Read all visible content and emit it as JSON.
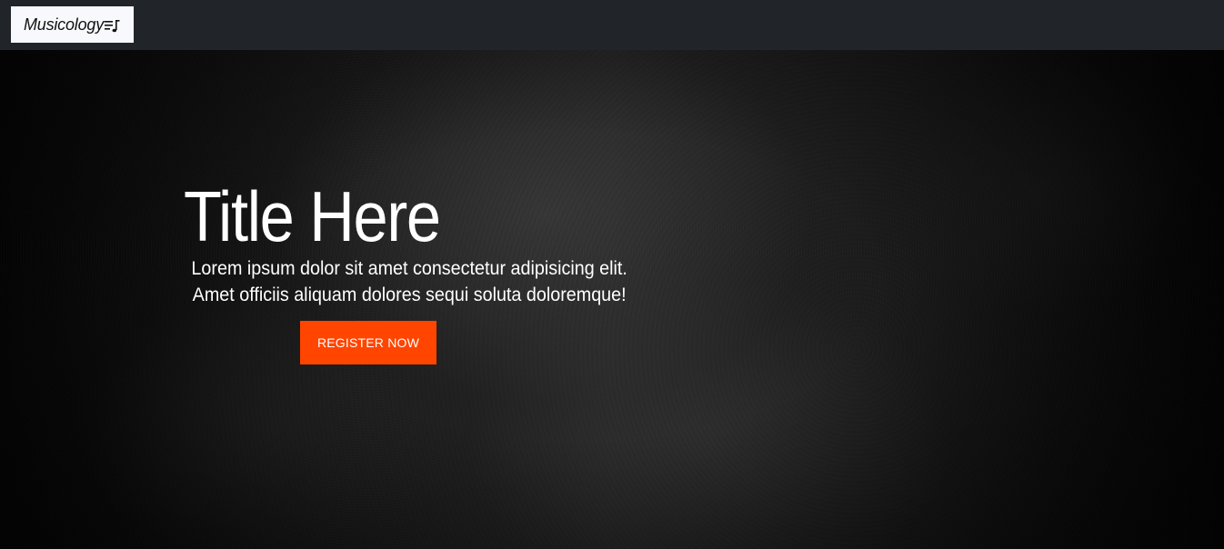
{
  "navbar": {
    "brand_text": "Musicology",
    "brand_icon": "music-playlist-icon",
    "background": "#212529"
  },
  "hero": {
    "title": "Title Here",
    "subtitle_line1": "Lorem ipsum dolor sit amet consectetur adipisicing elit.",
    "subtitle_line2": "Amet officiis aliquam dolores sequi soluta doloremque!",
    "cta_label": "REGISTER NOW",
    "cta_color": "#ff4500"
  }
}
